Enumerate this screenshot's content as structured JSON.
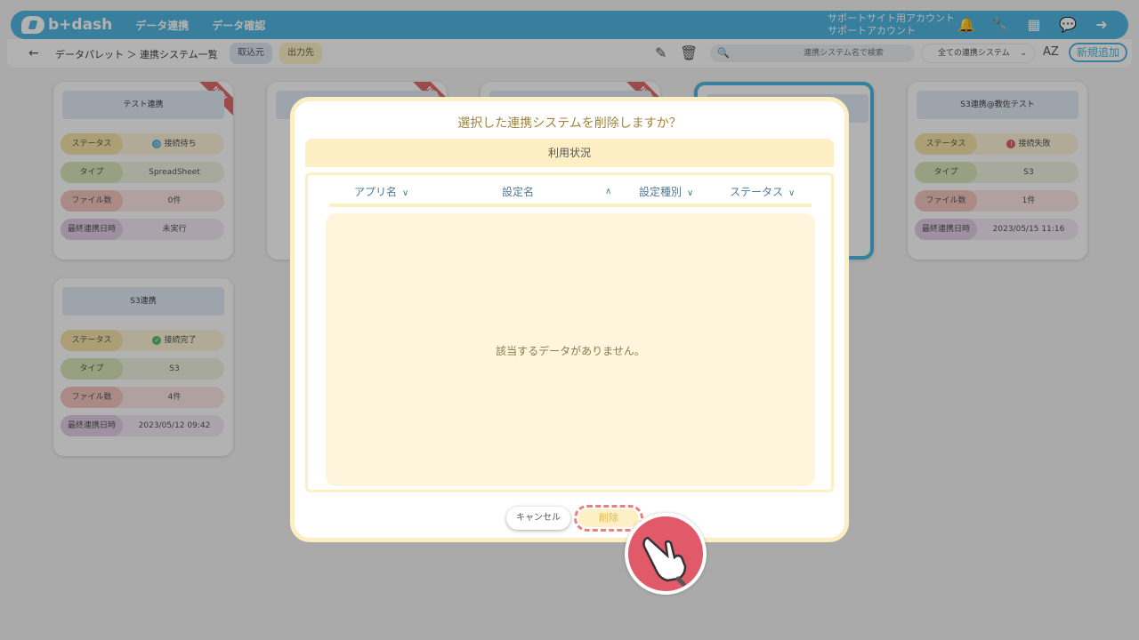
{
  "header": {
    "logo_text": "b+dash",
    "nav": [
      "データ連携",
      "データ確認"
    ],
    "account_line1": "サポートサイト用アカウント",
    "account_line2": "サポートアカウント",
    "icons": [
      "bell-icon",
      "wrench-icon",
      "grid-icon",
      "chat-icon",
      "logout-icon"
    ]
  },
  "toolbar": {
    "breadcrumb": "データパレット ＞ 連携システム一覧",
    "tab_in": "取込元",
    "tab_out": "出力先",
    "search_placeholder": "連携システム名で検索",
    "filter_value": "全ての連携システム",
    "new_button": "新規追加"
  },
  "cards": [
    {
      "title": "テスト連携",
      "new_badge": "NEW",
      "status_label": "ステータス",
      "status": "接続待ち",
      "type_label": "タイプ",
      "type": "SpreadSheet",
      "files_label": "ファイル数",
      "files": "0件",
      "last_label": "最終連携日時",
      "last": "未実行"
    },
    {
      "title": "S3連携",
      "status_label": "ステータス",
      "status": "接続完了",
      "type_label": "タイプ",
      "type": "S3",
      "files_label": "ファイル数",
      "files": "4件",
      "last_label": "最終連携日時",
      "last": "2023/05/12 09:42"
    },
    {
      "title": "S3連携@教佐テスト",
      "status_label": "ステータス",
      "status": "接続失敗",
      "type_label": "タイプ",
      "type": "S3",
      "files_label": "ファイル数",
      "files": "1件",
      "last_label": "最終連携日時",
      "last": "2023/05/15 11:16"
    },
    {
      "new_badge": "NEW"
    },
    {
      "new_badge": "NEW"
    }
  ],
  "modal": {
    "title": "選択した連携システムを削除しますか？",
    "section_title": "利用状況",
    "columns": [
      "アプリ名",
      "設定名",
      "設定種別",
      "ステータス"
    ],
    "empty_message": "該当するデータがありません。",
    "cancel_label": "キャンセル",
    "delete_label": "削除"
  },
  "colors": {
    "brand": "#4fb7e0",
    "modal_border": "#fcefc4",
    "pointer": "#e05a6a"
  }
}
